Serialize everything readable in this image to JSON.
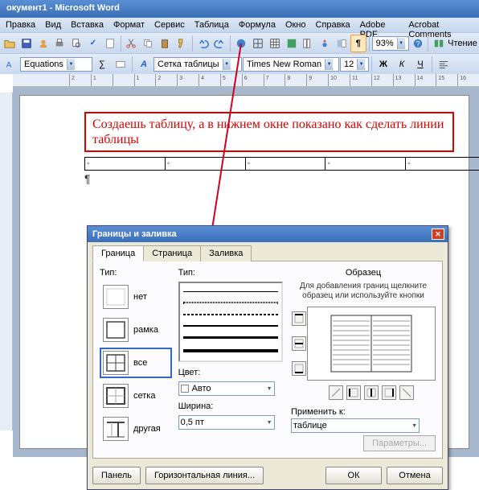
{
  "title": "окумент1 - Microsoft Word",
  "menu": [
    "Правка",
    "Вид",
    "Вставка",
    "Формат",
    "Сервис",
    "Таблица",
    "Формула",
    "Окно",
    "Справка",
    "Adobe PDF",
    "Acrobat Comments"
  ],
  "toolbar1": {
    "zoom": "93%",
    "read": "Чтение"
  },
  "toolbar2": {
    "style_label": "Equations",
    "table_style": "Сетка таблицы",
    "font": "Times New Roman",
    "size": "12",
    "bold": "Ж",
    "italic": "К",
    "underline": "Ч"
  },
  "ruler_marks": [
    "2",
    "1",
    "",
    "1",
    "2",
    "3",
    "4",
    "5",
    "6",
    "7",
    "8",
    "9",
    "10",
    "11",
    "12",
    "13",
    "14",
    "15",
    "16"
  ],
  "banner": "Создаешь таблицу, а в нижнем окне показано как сделать линии таблицы",
  "table_cells": [
    "◦",
    "◦",
    "◦",
    "◦",
    "◦"
  ],
  "para": "¶",
  "dialog": {
    "title": "Границы и заливка",
    "tabs": [
      "Граница",
      "Страница",
      "Заливка"
    ],
    "type_label": "Тип:",
    "types": [
      "нет",
      "рамка",
      "все",
      "сетка",
      "другая"
    ],
    "style_label": "Тип:",
    "color_label": "Цвет:",
    "color_value": "Авто",
    "width_label": "Ширина:",
    "width_value": "0,5 пт",
    "preview_label": "Образец",
    "preview_hint": "Для добавления границ щелкните образец или используйте кнопки",
    "apply_label": "Применить к:",
    "apply_value": "таблице",
    "params": "Параметры...",
    "panel": "Панель",
    "hline": "Горизонтальная линия...",
    "ok": "ОК",
    "cancel": "Отмена"
  }
}
